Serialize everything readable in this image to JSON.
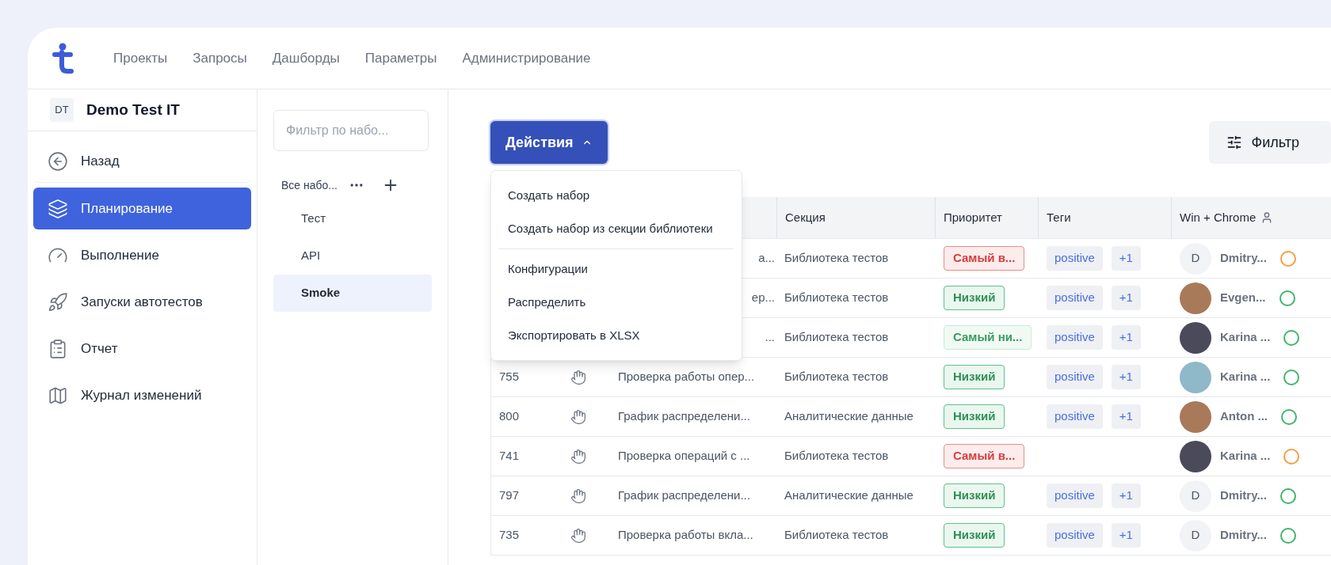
{
  "nav": {
    "items": [
      "Проекты",
      "Запросы",
      "Дашборды",
      "Параметры",
      "Администрирование"
    ]
  },
  "project": {
    "initials": "DT",
    "name": "Demo Test IT"
  },
  "sidebar": {
    "items": [
      {
        "label": "Назад",
        "selected": false
      },
      {
        "label": "Планирование",
        "selected": true
      },
      {
        "label": "Выполнение",
        "selected": false
      },
      {
        "label": "Запуски автотестов",
        "selected": false
      },
      {
        "label": "Отчет",
        "selected": false
      },
      {
        "label": "Журнал изменений",
        "selected": false
      }
    ]
  },
  "sets": {
    "filter_placeholder": "Фильтр по набо...",
    "root": "Все набо...",
    "items": [
      {
        "label": "Тест",
        "selected": false
      },
      {
        "label": "API",
        "selected": false
      },
      {
        "label": "Smoke",
        "selected": true
      }
    ]
  },
  "actions": {
    "label": "Действия",
    "expanded": true,
    "menu": [
      {
        "label": "Создать набор",
        "divider_after": false
      },
      {
        "label": "Создать набор из секции библиотеки",
        "divider_after": true
      },
      {
        "label": "Конфигурации",
        "divider_after": false
      },
      {
        "label": "Распределить",
        "divider_after": false
      },
      {
        "label": "Экспортировать в XLSX",
        "divider_after": false
      }
    ]
  },
  "filter_button": "Фильтр",
  "table": {
    "columns": [
      "Секция",
      "Приоритет",
      "Теги",
      "Win + Chrome"
    ],
    "rows": [
      {
        "name": "а...",
        "section": "Библиотека тестов",
        "priority": {
          "label": "Самый в...",
          "kind": "highest"
        },
        "tags": [
          "positive",
          "+1"
        ],
        "user": {
          "kind": "initial",
          "initial": "D",
          "name": "Dmitry..."
        },
        "color": "#f59e42"
      },
      {
        "name": "ер...",
        "section": "Библиотека тестов",
        "priority": {
          "label": "Низкий",
          "kind": "low"
        },
        "tags": [
          "positive",
          "+1"
        ],
        "user": {
          "kind": "photo",
          "name": "Evgen..."
        },
        "color": "#3fb66b"
      },
      {
        "name": "...",
        "section": "Библиотека тестов",
        "priority": {
          "label": "Самый ни...",
          "kind": "lowest"
        },
        "tags": [
          "positive",
          "+1"
        ],
        "user": {
          "kind": "photo",
          "name": "Karina ..."
        },
        "color": "#3fb66b"
      },
      {
        "id": "755",
        "name": "Проверка работы опер...",
        "section": "Библиотека тестов",
        "priority": {
          "label": "Низкий",
          "kind": "low"
        },
        "tags": [
          "positive",
          "+1"
        ],
        "user": {
          "kind": "photo",
          "name": "Karina ..."
        },
        "color": "#3fb66b"
      },
      {
        "id": "800",
        "name": "График распределени...",
        "section": "Аналитические данные",
        "priority": {
          "label": "Низкий",
          "kind": "low"
        },
        "tags": [
          "positive",
          "+1"
        ],
        "user": {
          "kind": "photo",
          "name": "Anton ..."
        },
        "color": "#3fb66b"
      },
      {
        "id": "741",
        "name": "Проверка операций с ...",
        "section": "Библиотека тестов",
        "priority": {
          "label": "Самый в...",
          "kind": "highest"
        },
        "tags": [],
        "user": {
          "kind": "photo",
          "name": "Karina ..."
        },
        "color": "#f59e42"
      },
      {
        "id": "797",
        "name": "График распределени...",
        "section": "Аналитические данные",
        "priority": {
          "label": "Низкий",
          "kind": "low"
        },
        "tags": [
          "positive",
          "+1"
        ],
        "user": {
          "kind": "initial",
          "initial": "D",
          "name": "Dmitry..."
        },
        "color": "#3fb66b"
      },
      {
        "id": "735",
        "name": "Проверка работы вкла...",
        "section": "Библиотека тестов",
        "priority": {
          "label": "Низкий",
          "kind": "low"
        },
        "tags": [
          "positive",
          "+1"
        ],
        "user": {
          "kind": "initial",
          "initial": "D",
          "name": "Dmitry..."
        },
        "color": "#3fb66b"
      }
    ]
  }
}
